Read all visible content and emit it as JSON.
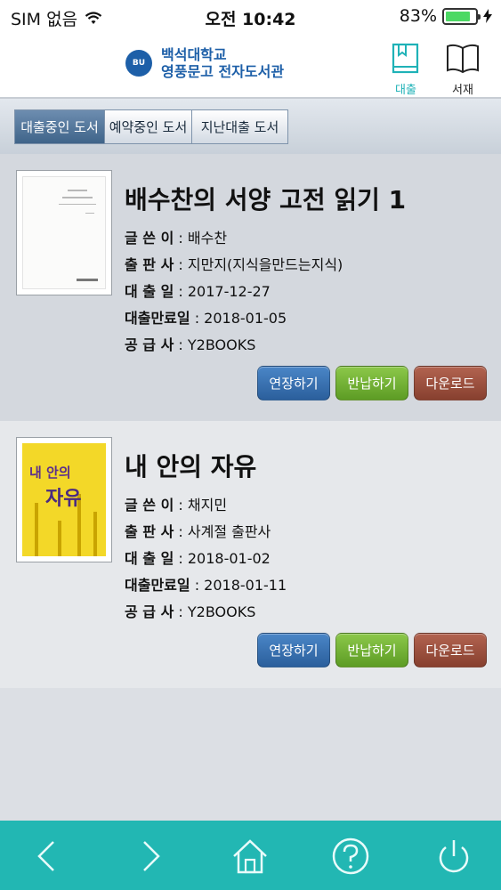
{
  "status": {
    "carrier": "SIM 없음",
    "time": "오전 10:42",
    "battery": "83%",
    "battery_level": 0.83
  },
  "header": {
    "logo_mark": "BU",
    "title_line1": "백석대학교",
    "title_line2": "영풍문고 전자도서관",
    "loan_label": "대출",
    "shelf_label": "서재"
  },
  "tabs": [
    "대출중인 도서",
    "예약중인 도서",
    "지난대출 도서"
  ],
  "field_labels": {
    "author": "글 쓴 이",
    "publisher": "출 판 사",
    "loan_date": "대 출 일",
    "due_date": "대출만료일",
    "supplier": "공 급 사"
  },
  "buttons": {
    "extend": "연장하기",
    "return": "반납하기",
    "download": "다운로드"
  },
  "books": [
    {
      "title": "배수찬의 서양 고전 읽기 1",
      "author": " : 배수찬",
      "publisher": " : 지만지(지식을만드는지식)",
      "loan_date": " : 2017-12-27",
      "due_date": " : 2018-01-05",
      "supplier": " : Y2BOOKS"
    },
    {
      "title": "내 안의 자유",
      "cover_text1": "내 안의",
      "cover_text2": "자유",
      "author": " : 채지민",
      "publisher": " : 사계절 출판사",
      "loan_date": " : 2018-01-02",
      "due_date": " : 2018-01-11",
      "supplier": " : Y2BOOKS"
    }
  ],
  "colors": {
    "accent": "#22b7b3",
    "brand": "#1d5fa8",
    "blue_btn": "#2b5f9c",
    "green_btn": "#5d9c25",
    "brown_btn": "#87402f"
  },
  "bottom_nav": [
    "back-icon",
    "forward-icon",
    "home-icon",
    "help-icon",
    "power-icon"
  ]
}
